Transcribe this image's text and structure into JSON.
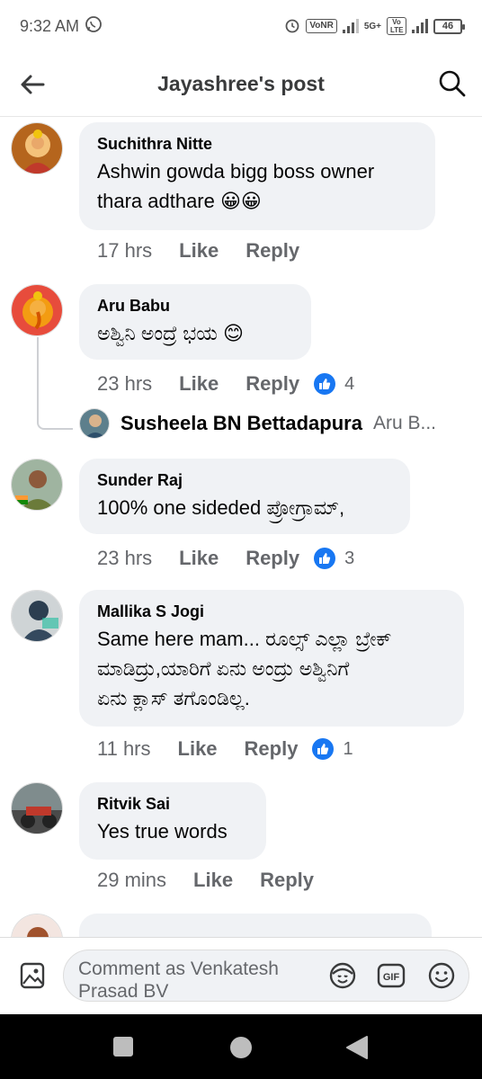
{
  "status_bar": {
    "time": "9:32 AM",
    "volte_label": "VoNR",
    "network_label": "5G+",
    "lte_label": "Vo LTE",
    "battery": "46"
  },
  "header": {
    "title": "Jayashree's post"
  },
  "comments": [
    {
      "author": "Suchithra Nitte",
      "text": "Ashwin gowda bigg boss owner\nthara adthare 😀😀",
      "time": "17 hrs",
      "like_label": "Like",
      "reply_label": "Reply",
      "reactions": ""
    },
    {
      "author": "Aru Babu",
      "text": "ಅಶ್ವಿನಿ ಅಂದ್ರೆ ಭಯ 😊",
      "time": "23 hrs",
      "like_label": "Like",
      "reply_label": "Reply",
      "reactions": "4"
    },
    {
      "author": "Sunder Raj",
      "text": "100% one sideded ಪ್ರೋಗ್ರಾಮ್,",
      "time": "23 hrs",
      "like_label": "Like",
      "reply_label": "Reply",
      "reactions": "3"
    },
    {
      "author": "Mallika S Jogi",
      "text": "Same here mam... ರೂಲ್ಸ್ ಎಲ್ಲಾ ಬ್ರೇಕ್\nಮಾಡಿದ್ರು,ಯಾರಿಗೆ ಏನು ಅಂದ್ರು ಅಶ್ವಿನಿಗೆ\nಏನು ಕ್ಲಾಸ್ ತಗೊಂಡಿಲ್ಲ.",
      "time": "11 hrs",
      "like_label": "Like",
      "reply_label": "Reply",
      "reactions": "1"
    },
    {
      "author": "Ritvik Sai",
      "text": "Yes true words",
      "time": "29 mins",
      "like_label": "Like",
      "reply_label": "Reply",
      "reactions": ""
    }
  ],
  "reply_preview": {
    "author": "Susheela BN Bettadapura",
    "text": "Aru B..."
  },
  "composer": {
    "placeholder": "Comment as Venkatesh Prasad BV"
  },
  "colors": {
    "bubble": "#f0f2f5",
    "meta_text": "#65676b",
    "like_blue": "#1877f2"
  }
}
